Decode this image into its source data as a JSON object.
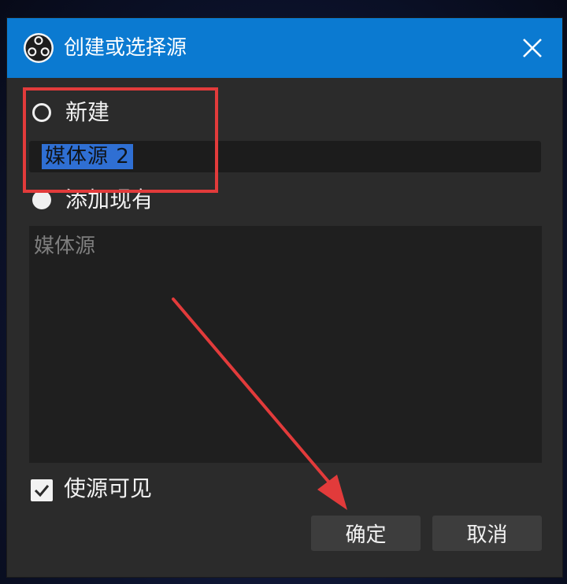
{
  "dialog": {
    "title": "创建或选择源",
    "icon": "obs-logo-icon",
    "close_icon": "close-icon"
  },
  "options": {
    "new_label": "新建",
    "new_name_value": "媒体源 2",
    "existing_label": "添加现有",
    "existing_sources": [
      "媒体源"
    ]
  },
  "visibility": {
    "label": "使源可见",
    "checked": true
  },
  "buttons": {
    "ok": "确定",
    "cancel": "取消"
  },
  "annotation": {
    "color": "#e23b3b"
  },
  "colors": {
    "titlebar": "#0b7ad1",
    "dialog_bg": "#2b2b2b",
    "selection": "#2f6fd3"
  }
}
